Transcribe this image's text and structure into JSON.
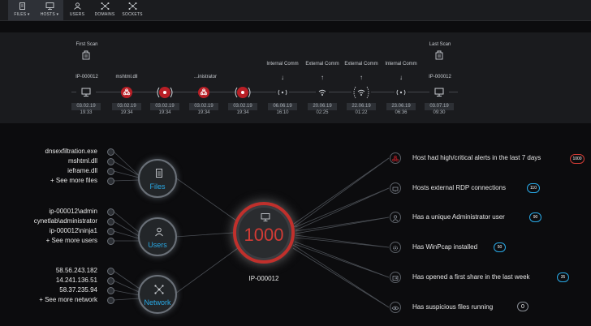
{
  "nav": [
    {
      "label": "FILES ▾",
      "icon": "file-icon",
      "active": true
    },
    {
      "label": "HOSTS ▾",
      "icon": "monitor-icon",
      "active": true
    },
    {
      "label": "USERS",
      "icon": "user-icon",
      "active": false
    },
    {
      "label": "DOMAINS",
      "icon": "network-icon",
      "active": false
    },
    {
      "label": "SOCKETS",
      "icon": "network-icon",
      "active": false
    }
  ],
  "timeline": {
    "first_scan": "First Scan",
    "last_scan": "Last Scan",
    "start_host": "IP-000012",
    "end_host": "IP-000012",
    "events": [
      {
        "label": "",
        "date": "03.02.19",
        "time": "19:33",
        "kind": "host"
      },
      {
        "label": "mshtml.dll",
        "date": "03.02.19",
        "time": "19:34",
        "kind": "alert"
      },
      {
        "label": "",
        "date": "03.02.19",
        "time": "19:34",
        "kind": "alert-signal"
      },
      {
        "label": "...inistrator",
        "date": "03.02.19",
        "time": "19:34",
        "kind": "alert"
      },
      {
        "label": "",
        "date": "03.02.19",
        "time": "19:34",
        "kind": "alert-signal"
      },
      {
        "label": "Internal Comm",
        "arrow": "↓",
        "date": "06.06.19",
        "time": "16:10",
        "kind": "comm"
      },
      {
        "label": "External Comm",
        "arrow": "↑",
        "date": "20.06.19",
        "time": "02:25",
        "kind": "wifi"
      },
      {
        "label": "External Comm",
        "arrow": "↑",
        "date": "22.06.19",
        "time": "01:22",
        "kind": "wifi-big"
      },
      {
        "label": "Internal Comm",
        "arrow": "↓",
        "date": "23.06.19",
        "time": "06:36",
        "kind": "comm"
      },
      {
        "label": "",
        "date": "03.07.19",
        "time": "09:30",
        "kind": "host"
      }
    ]
  },
  "groups": {
    "files": {
      "title": "Files",
      "items": [
        "dnsexfiltration.exe",
        "mshtml.dll",
        "ieframe.dll",
        "+ See more files"
      ]
    },
    "users": {
      "title": "Users",
      "items": [
        "ip-000012\\admin",
        "cynetlab\\administrator",
        "ip-000012\\ninja1",
        "+ See more users"
      ]
    },
    "network": {
      "title": "Network",
      "items": [
        "58.56.243.182",
        "14.241.136.51",
        "58.37.235.94",
        "+ See more network"
      ]
    }
  },
  "center": {
    "score": "1000",
    "host": "IP-000012",
    "color": "#d23b35"
  },
  "alerts": [
    {
      "text": "Host had high/critical alerts in the last 7 days",
      "badge": "1000",
      "badge_color": "#d23b35",
      "icon": "biohazard-icon"
    },
    {
      "text": "Hosts external RDP connections",
      "badge": "110",
      "badge_color": "#29a9e6",
      "icon": "rdp-icon"
    },
    {
      "text": "Has a unique Administrator user",
      "badge": "90",
      "badge_color": "#29a9e6",
      "icon": "user-icon"
    },
    {
      "text": "Has WinPcap installed",
      "badge": "50",
      "badge_color": "#29a9e6",
      "icon": "gear-icon"
    },
    {
      "text": "Has opened a first share in the last week",
      "badge": "35",
      "badge_color": "#29a9e6",
      "icon": "share-icon"
    },
    {
      "text": "Has suspicious files running",
      "badge": "0",
      "badge_color": "#8a8f96",
      "icon": "eye-icon"
    }
  ]
}
